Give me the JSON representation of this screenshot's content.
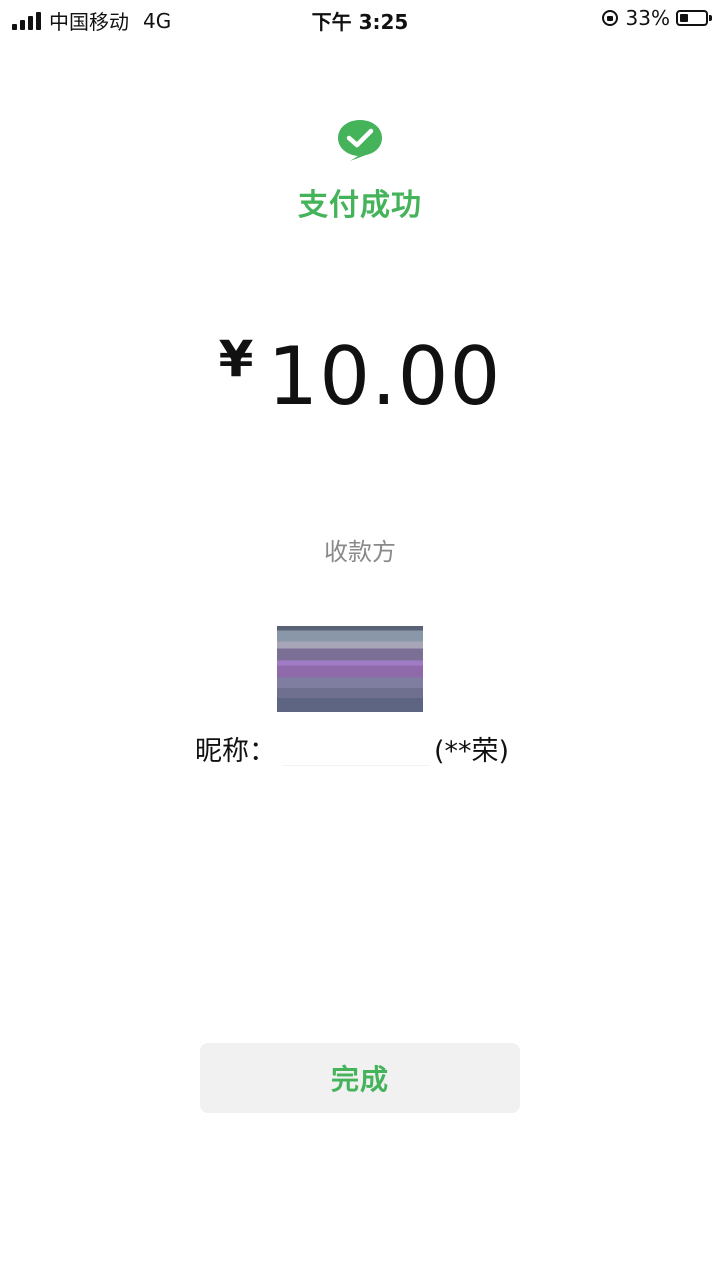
{
  "status_bar": {
    "carrier": "中国移动",
    "network": "4G",
    "time": "下午 3:25",
    "battery_percent": "33%"
  },
  "result": {
    "title": "支付成功",
    "status_color": "#44b35a",
    "icon": "wechat-pay-check-icon"
  },
  "payment": {
    "currency_symbol": "¥",
    "amount": "10.00"
  },
  "payee": {
    "label": "收款方",
    "nickname_prefix": "昵称：",
    "name_masked": "(**荣)"
  },
  "actions": {
    "done_label": "完成"
  }
}
